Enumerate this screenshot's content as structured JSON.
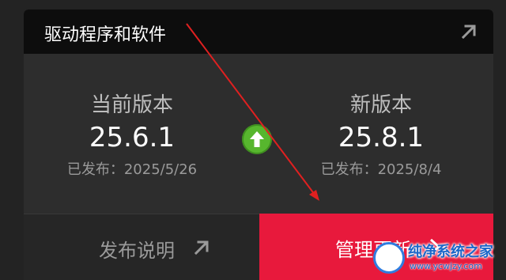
{
  "header": {
    "title": "驱动程序和软件"
  },
  "current": {
    "label": "当前版本",
    "version": "25.6.1",
    "released": "已发布：2025/5/26"
  },
  "latest": {
    "label": "新版本",
    "version": "25.8.1",
    "released": "已发布：2025/8/4"
  },
  "footer": {
    "notes_label": "发布说明",
    "manage_label": "管理更新"
  },
  "watermark": {
    "name": "纯净系统之家",
    "url": "www.ycwjzy.com"
  },
  "colors": {
    "accent": "#e8193c",
    "upgrade": "#57b62e",
    "annotation": "#e02020"
  },
  "icons": {
    "header": "external-link-icon",
    "notes": "external-link-icon",
    "manage": "chevron-right-icon",
    "upgrade": "up-arrow-icon"
  }
}
